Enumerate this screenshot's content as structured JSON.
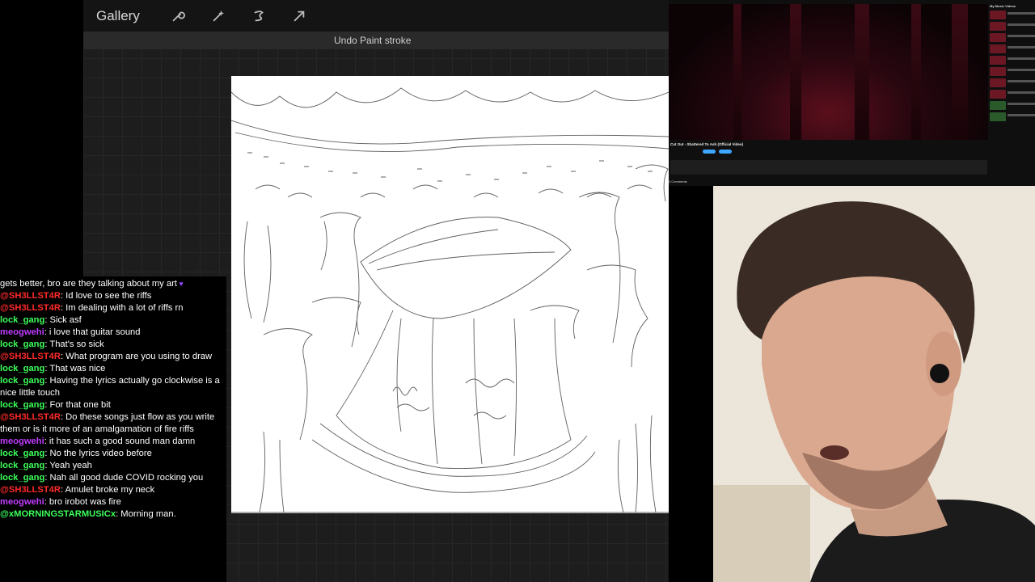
{
  "app": {
    "gallery_label": "Gallery",
    "undo_status": "Undo Paint stroke",
    "tools": [
      "wrench-icon",
      "magic-wand-icon",
      "selection-icon",
      "transform-arrow-icon"
    ]
  },
  "chat": {
    "messages": [
      {
        "user": "",
        "text": "gets better, bro are they talking about my art",
        "color": "#ffffff"
      },
      {
        "user": "@SH3LLST4R",
        "text": ": Id love to see the riffs",
        "color": "#ff2a2a"
      },
      {
        "user": "@SH3LLST4R",
        "text": ": Im dealing with a lot of riffs rn",
        "color": "#ff2a2a"
      },
      {
        "user": "lock_gang",
        "text": ": Sick asf",
        "color": "#3cff5a"
      },
      {
        "user": "meogwehi",
        "text": ": i love that guitar sound",
        "color": "#c13cff"
      },
      {
        "user": "lock_gang",
        "text": ": That's so sick",
        "color": "#3cff5a"
      },
      {
        "user": "@SH3LLST4R",
        "text": ": What program are you using to draw",
        "color": "#ff2a2a"
      },
      {
        "user": "lock_gang",
        "text": ": That was nice",
        "color": "#3cff5a"
      },
      {
        "user": "lock_gang",
        "text": ": Having the lyrics actually go clockwise is a nice little touch",
        "color": "#3cff5a"
      },
      {
        "user": "lock_gang",
        "text": ": For that one bit",
        "color": "#3cff5a"
      },
      {
        "user": "@SH3LLST4R",
        "text": ": Do these songs just flow as you write them or is it more of an amalgamation of fire riffs",
        "color": "#ff2a2a"
      },
      {
        "user": "meogwehi",
        "text": ": it has such a good sound man damn",
        "color": "#c13cff"
      },
      {
        "user": "lock_gang",
        "text": ": No the lyrics video before",
        "color": "#3cff5a"
      },
      {
        "user": "lock_gang",
        "text": ": Yeah yeah",
        "color": "#3cff5a"
      },
      {
        "user": "lock_gang",
        "text": ": Nah all good dude COVID rocking you",
        "color": "#3cff5a"
      },
      {
        "user": "@SH3LLST4R",
        "text": ": Amulet broke my neck",
        "color": "#ff2a2a"
      },
      {
        "user": "meogwehi",
        "text": ": bro irobot was fire",
        "color": "#c13cff"
      },
      {
        "user": "@xMORNINGSTARMUSICx",
        "text": ": Morning man.",
        "color": "#3cff5a"
      }
    ]
  },
  "youtube": {
    "video_title": "Cut Out - Shattered To Ash (Official Video)",
    "comments_label": "3 Comments",
    "sidebar_heading": "My Music Videos"
  }
}
